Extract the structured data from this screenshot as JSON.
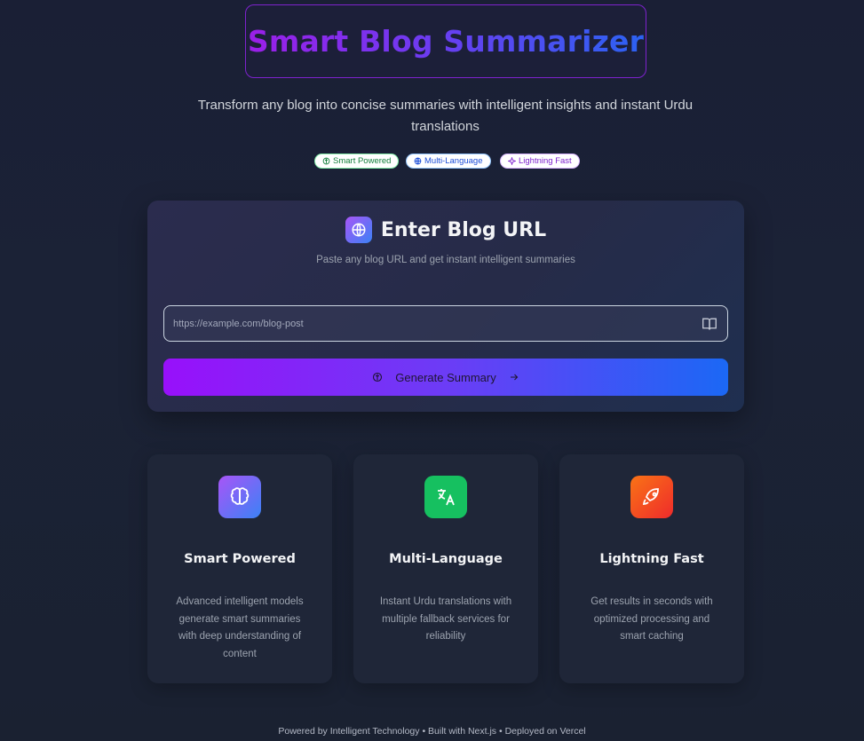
{
  "header": {
    "title": "Smart Blog Summarizer",
    "subtitle": "Transform any blog into concise summaries with intelligent insights and instant Urdu translations"
  },
  "badges": [
    {
      "label": "Smart Powered",
      "icon": "brain-icon",
      "color": "#15803d"
    },
    {
      "label": "Multi-Language",
      "icon": "globe-icon",
      "color": "#1d4ed8"
    },
    {
      "label": "Lightning Fast",
      "icon": "sparkle-icon",
      "color": "#7e22ce"
    }
  ],
  "url_card": {
    "title": "Enter Blog URL",
    "subtitle": "Paste any blog URL and get instant intelligent summaries",
    "input_placeholder": "https://example.com/blog-post",
    "input_value": "",
    "button_label": "Generate Summary"
  },
  "features": [
    {
      "title": "Smart Powered",
      "description": "Advanced intelligent models generate smart summaries with deep understanding of content",
      "icon": "brain-icon",
      "color": "#8b5cf6"
    },
    {
      "title": "Multi-Language",
      "description": "Instant Urdu translations with multiple fallback services for reliability",
      "icon": "translate-icon",
      "color": "#16c060"
    },
    {
      "title": "Lightning Fast",
      "description": "Get results in seconds with optimized processing and smart caching",
      "icon": "rocket-icon",
      "color": "#f97316"
    }
  ],
  "footer": {
    "text": "Powered by Intelligent Technology • Built with Next.js • Deployed on Vercel"
  }
}
